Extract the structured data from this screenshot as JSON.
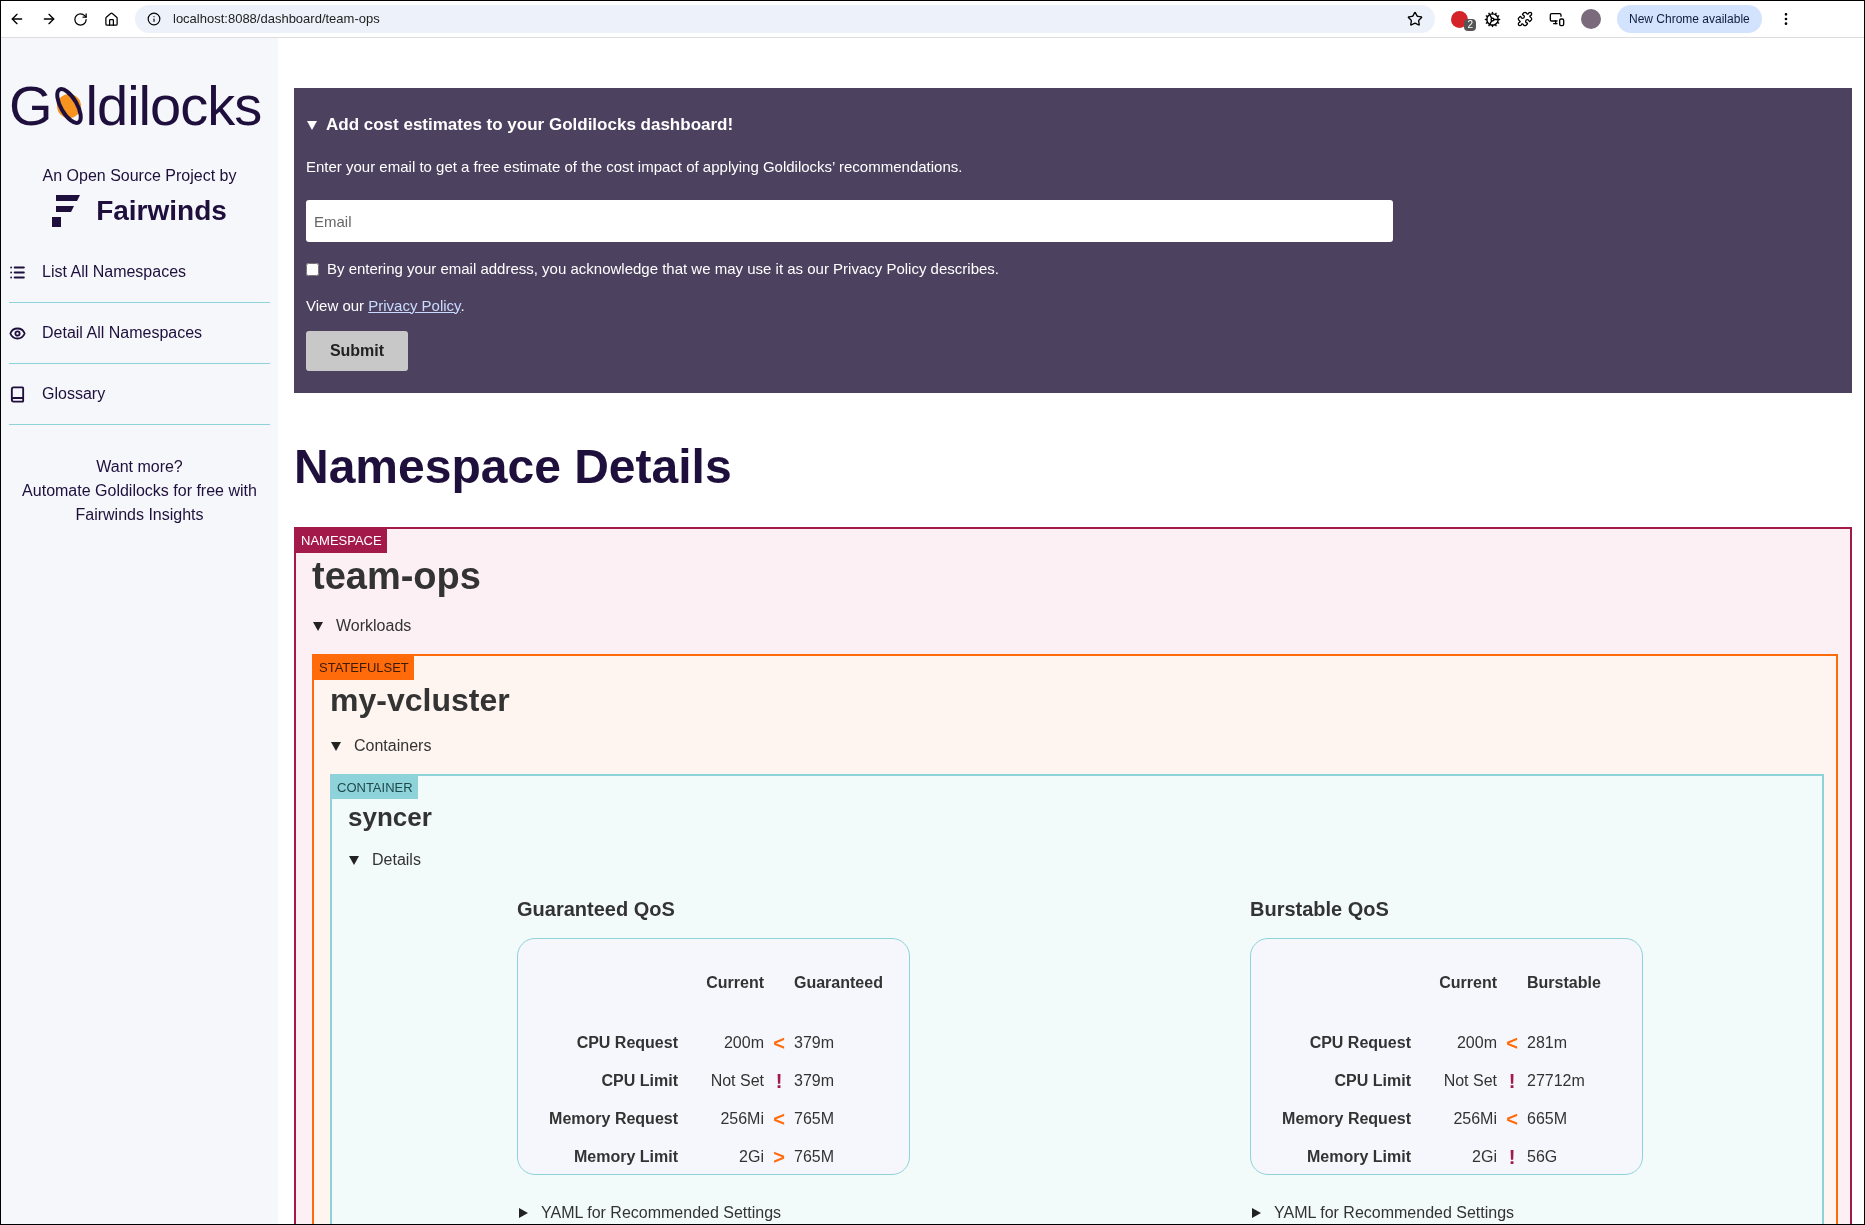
{
  "browser": {
    "url": "localhost:8088/dashboard/team-ops",
    "extension_badge": "2",
    "update_button": "New Chrome available"
  },
  "sidebar": {
    "logo": [
      "G",
      "ldilocks"
    ],
    "byline": "An Open Source Project by",
    "brand": "Fairwinds",
    "items": [
      {
        "label": "List All Namespaces",
        "kind": "list"
      },
      {
        "label": "Detail All Namespaces",
        "kind": "eye"
      },
      {
        "label": "Glossary",
        "kind": "book"
      }
    ],
    "promo": [
      "Want more?",
      "Automate Goldilocks for free with",
      "Fairwinds Insights"
    ]
  },
  "banner": {
    "title": "Add cost estimates to your Goldilocks dashboard!",
    "expanded": true,
    "text": "Enter your email to get a free estimate of the cost impact of applying Goldilocks’ recommendations.",
    "email_placeholder": "Email",
    "consent": "By entering your email address, you acknowledge that we may use it as our Privacy Policy describes.",
    "consent_checked": false,
    "view_prefix": "View our ",
    "privacy_link": "Privacy Policy",
    "view_suffix": ".",
    "submit": "Submit"
  },
  "heading": "Namespace Details",
  "namespace": {
    "tag": "NAMESPACE",
    "name": "team-ops",
    "section": "Workloads",
    "expanded": true,
    "workload": {
      "tag": "STATEFULSET",
      "name": "my-vcluster",
      "section": "Containers",
      "expanded": true,
      "container": {
        "tag": "CONTAINER",
        "name": "syncer",
        "section": "Details",
        "expanded": true,
        "qos": [
          {
            "title": "Guaranteed QoS",
            "col_current": "Current",
            "col_recommended": "Guaranteed",
            "yaml": "YAML for Recommended Settings",
            "yaml_expanded": false,
            "rows": [
              {
                "label": "CPU Request",
                "current": "200m",
                "symbol": "<",
                "kind": "under",
                "recommended": "379m"
              },
              {
                "label": "CPU Limit",
                "current": "Not Set",
                "symbol": "!",
                "kind": "unset",
                "recommended": "379m"
              },
              {
                "label": "Memory Request",
                "current": "256Mi",
                "symbol": "<",
                "kind": "under",
                "recommended": "765M"
              },
              {
                "label": "Memory Limit",
                "current": "2Gi",
                "symbol": ">",
                "kind": "over",
                "recommended": "765M"
              }
            ]
          },
          {
            "title": "Burstable QoS",
            "col_current": "Current",
            "col_recommended": "Burstable",
            "yaml": "YAML for Recommended Settings",
            "yaml_expanded": false,
            "rows": [
              {
                "label": "CPU Request",
                "current": "200m",
                "symbol": "<",
                "kind": "under",
                "recommended": "281m"
              },
              {
                "label": "CPU Limit",
                "current": "Not Set",
                "symbol": "!",
                "kind": "unset",
                "recommended": "27712m"
              },
              {
                "label": "Memory Request",
                "current": "256Mi",
                "symbol": "<",
                "kind": "under",
                "recommended": "665M"
              },
              {
                "label": "Memory Limit",
                "current": "2Gi",
                "symbol": "!",
                "kind": "unset",
                "recommended": "56G"
              }
            ]
          }
        ]
      }
    }
  }
}
